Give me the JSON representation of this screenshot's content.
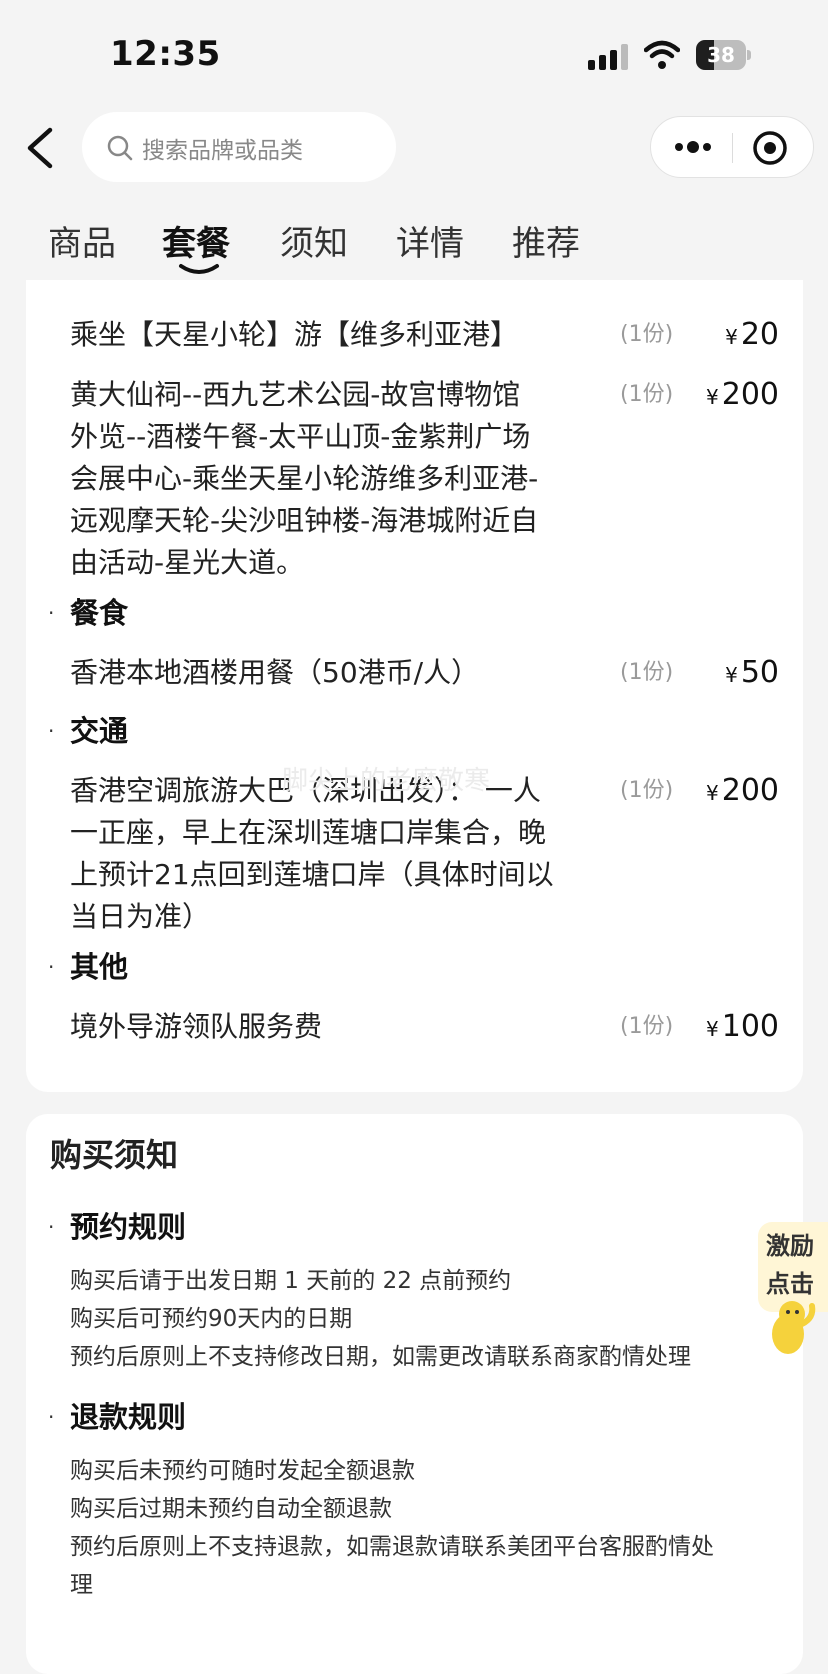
{
  "status_bar": {
    "time": "12:35",
    "battery": "38"
  },
  "nav": {
    "search_placeholder": "搜索品牌或品类"
  },
  "tabs": [
    {
      "label": "商品"
    },
    {
      "label": "套餐"
    },
    {
      "label": "须知"
    },
    {
      "label": "详情"
    },
    {
      "label": "推荐"
    }
  ],
  "package": {
    "currency": "¥",
    "items": [
      {
        "name_lines": [
          "乘坐【天星小轮】游【维多利亚港】"
        ],
        "qty": "(1份)",
        "price": "20"
      },
      {
        "name_lines": [
          "黄大仙祠--西九艺术公园-故宫博物馆",
          "外览--酒楼午餐-太平山顶-金紫荆广场",
          "会展中心-乘坐天星小轮游维多利亚港-",
          "远观摩天轮-尖沙咀钟楼-海港城附近自",
          "由活动-星光大道。"
        ],
        "qty": "(1份)",
        "price": "200"
      },
      {
        "name_lines": [
          "香港本地酒楼用餐（50港币/人）"
        ],
        "qty": "(1份)",
        "price": "50"
      },
      {
        "name_lines": [
          "香港空调旅游大巴（深圳出发）： 一人",
          "一正座，早上在深圳莲塘口岸集合，晚",
          "上预计21点回到莲塘口岸（具体时间以",
          "当日为准）"
        ],
        "qty": "(1份)",
        "price": "200"
      },
      {
        "name_lines": [
          "境外导游领队服务费"
        ],
        "qty": "(1份)",
        "price": "100"
      }
    ],
    "sections": [
      "餐食",
      "交通",
      "其他"
    ],
    "bullet": "·",
    "watermark": "脚尖上的老麽敬寒"
  },
  "notice": {
    "title": "购买须知",
    "booking_title": "预约规则",
    "booking_lines": [
      "购买后请于出发日期 1 天前的 22 点前预约",
      "购买后可预约90天内的日期",
      "预约后原则上不支持修改日期，如需更改请联系商家酌情处理"
    ],
    "refund_title": "退款规则",
    "refund_lines": [
      "购买后未预约可随时发起全额退款",
      "购买后过期未预约自动全额退款",
      "预约后原则上不支持退款，如需退款请联系美团平台客服酌情处",
      "理"
    ]
  },
  "float_badge": {
    "line1": "激励",
    "line2": "点击"
  }
}
